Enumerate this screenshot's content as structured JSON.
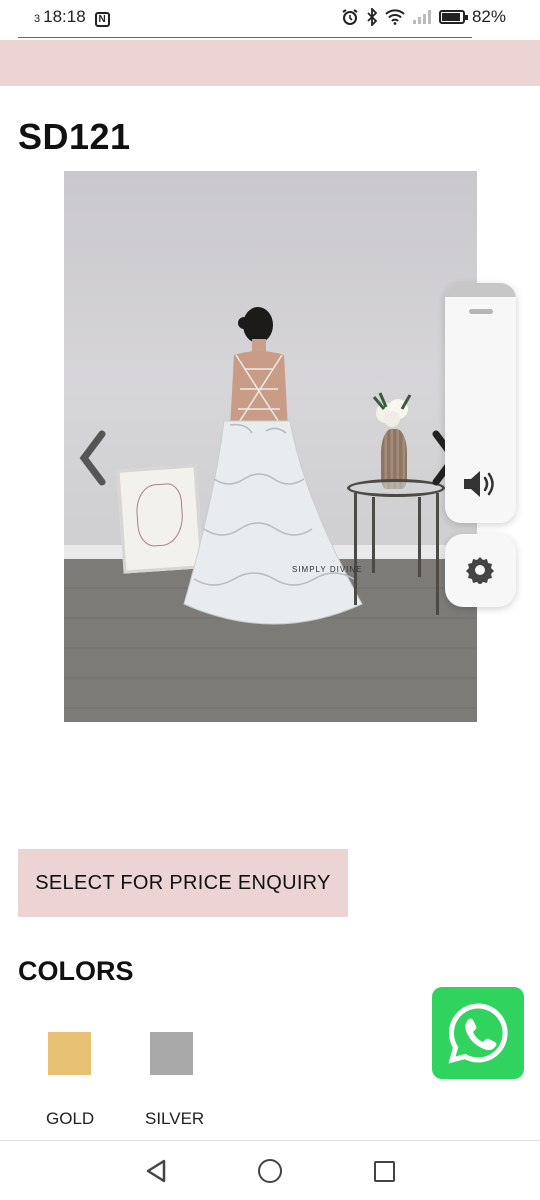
{
  "status_bar": {
    "sim": "3",
    "time": "18:18",
    "battery": "82%",
    "icons": [
      "nfc-icon",
      "alarm-icon",
      "bluetooth-icon",
      "wifi-icon",
      "signal-icon",
      "battery-icon"
    ]
  },
  "product": {
    "title": "SD121",
    "image_alt": "Model wearing a silver brocade lace-up back ball gown",
    "watermark": "SIMPLY DIVINE"
  },
  "gallery": {
    "prev_icon": "chevron-left-icon",
    "next_icon": "chevron-right-icon"
  },
  "floating_panel": {
    "volume_icon": "volume-icon",
    "settings_icon": "gear-icon"
  },
  "actions": {
    "enquiry_label": "SELECT FOR PRICE ENQUIRY"
  },
  "colors": {
    "heading": "COLORS",
    "options": [
      {
        "label": "GOLD",
        "hex": "#e8c175"
      },
      {
        "label": "SILVER",
        "hex": "#a9a9a9"
      }
    ]
  },
  "whatsapp": {
    "icon": "whatsapp-icon",
    "color": "#30d35d"
  },
  "theme": {
    "accent_pink": "#ecd3d4"
  },
  "nav_bar": {
    "icons": [
      "back-icon",
      "home-icon",
      "recents-icon"
    ]
  }
}
